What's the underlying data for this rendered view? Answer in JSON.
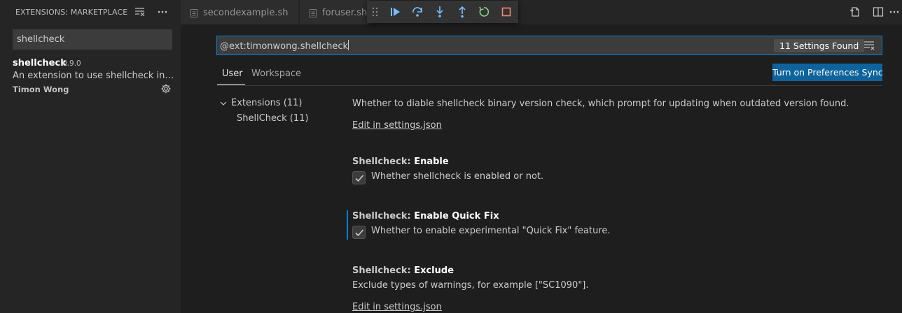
{
  "sidebar": {
    "title": "EXTENSIONS: MARKETPLACE",
    "search_value": "shellcheck",
    "extension": {
      "name": "shellcheck",
      "version": "0.9.0",
      "description": "An extension to use shellcheck in vscode",
      "author": "Timon Wong"
    }
  },
  "tabs": [
    {
      "label": "secondexample.sh"
    },
    {
      "label": "foruser.sh"
    }
  ],
  "settings": {
    "query": "@ext:timonwong.shellcheck",
    "count": "11 Settings Found",
    "scope_tabs": [
      "User",
      "Workspace"
    ],
    "sync_button": "Turn on Preferences Sync",
    "toc": {
      "root": "Extensions (11)",
      "child": "ShellCheck (11)"
    },
    "items": [
      {
        "description": "Whether to diable shellcheck binary version check, which prompt for updating when outdated version found.",
        "link": "Edit in settings.json"
      },
      {
        "category": "Shellcheck: ",
        "name": "Enable",
        "checkbox_label": "Whether shellcheck is enabled or not.",
        "checked": true
      },
      {
        "category": "Shellcheck: ",
        "name": "Enable Quick Fix",
        "checkbox_label": "Whether to enable experimental \"Quick Fix\" feature.",
        "checked": true
      },
      {
        "category": "Shellcheck: ",
        "name": "Exclude",
        "description": "Exclude types of warnings, for example [\"SC1090\"].",
        "link": "Edit in settings.json"
      }
    ]
  },
  "colors": {
    "accent": "#007fd4",
    "button": "#0e639c",
    "debug_continue": "#75beff",
    "debug_restart": "#89d185",
    "debug_stop": "#f48771"
  }
}
